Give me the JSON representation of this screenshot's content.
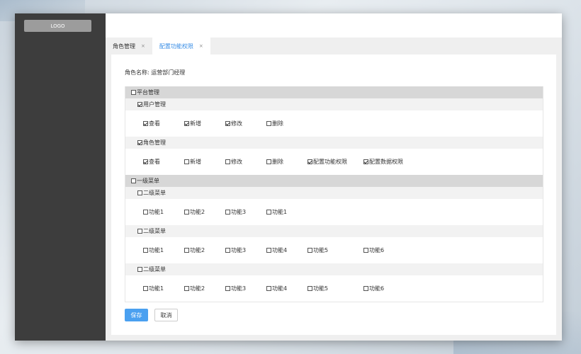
{
  "sidebar": {
    "logo": "LOGO"
  },
  "tabs": [
    {
      "label": "角色管理",
      "close": "×"
    },
    {
      "label": "配置功能权限",
      "close": "×"
    }
  ],
  "role": {
    "label": "角色名称:",
    "value": "运营部门经理"
  },
  "tree": [
    {
      "label": "平台管理",
      "checked": false,
      "children": [
        {
          "label": "用户管理",
          "checked": true,
          "perms": [
            {
              "label": "查看",
              "checked": true
            },
            {
              "label": "新增",
              "checked": true
            },
            {
              "label": "修改",
              "checked": true
            },
            {
              "label": "删除",
              "checked": false
            }
          ]
        },
        {
          "label": "角色管理",
          "checked": true,
          "perms": [
            {
              "label": "查看",
              "checked": true
            },
            {
              "label": "新增",
              "checked": false
            },
            {
              "label": "修改",
              "checked": false
            },
            {
              "label": "删除",
              "checked": false
            },
            {
              "label": "配置功能权限",
              "checked": true
            },
            {
              "label": "配置数据权限",
              "checked": true
            }
          ]
        }
      ]
    },
    {
      "label": "一级菜单",
      "checked": false,
      "children": [
        {
          "label": "二级菜单",
          "checked": false,
          "perms": [
            {
              "label": "功能1",
              "checked": false
            },
            {
              "label": "功能2",
              "checked": false
            },
            {
              "label": "功能3",
              "checked": false
            },
            {
              "label": "功能1",
              "checked": false
            }
          ]
        },
        {
          "label": "二级菜单",
          "checked": false,
          "perms": [
            {
              "label": "功能1",
              "checked": false
            },
            {
              "label": "功能2",
              "checked": false
            },
            {
              "label": "功能3",
              "checked": false
            },
            {
              "label": "功能4",
              "checked": false
            },
            {
              "label": "功能5",
              "checked": false
            },
            {
              "label": "功能6",
              "checked": false
            }
          ]
        },
        {
          "label": "二级菜单",
          "checked": false,
          "perms": [
            {
              "label": "功能1",
              "checked": false
            },
            {
              "label": "功能2",
              "checked": false
            },
            {
              "label": "功能3",
              "checked": false
            },
            {
              "label": "功能4",
              "checked": false
            },
            {
              "label": "功能5",
              "checked": false
            },
            {
              "label": "功能6",
              "checked": false
            }
          ]
        }
      ]
    }
  ],
  "buttons": {
    "save": "保存",
    "cancel": "取消"
  },
  "colors": {
    "accent": "#3a8ee6",
    "primary_button": "#4aa0f0",
    "sidebar": "#3d3d3d"
  }
}
